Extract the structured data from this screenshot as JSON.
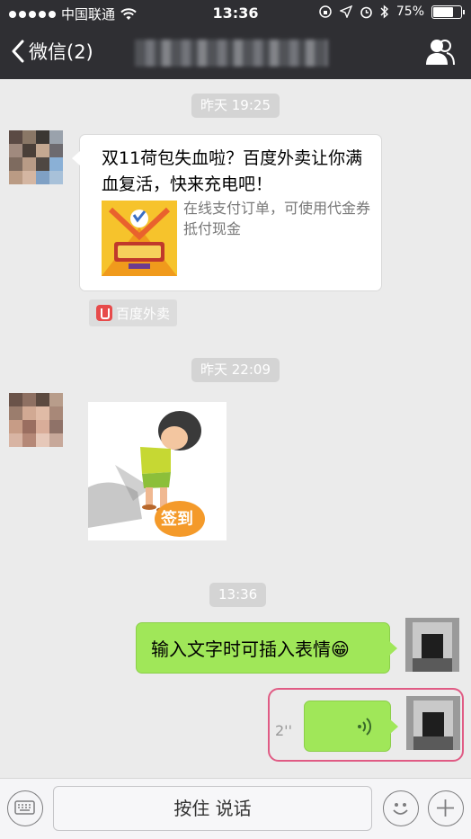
{
  "status_bar": {
    "carrier": "中国联通",
    "time": "13:36",
    "battery_percent": "75%",
    "battery_level": 0.75,
    "signal_bars_filled": 5,
    "icons": [
      "wifi-icon",
      "orientation-lock-icon",
      "location-icon",
      "alarm-icon",
      "bluetooth-icon",
      "battery-icon"
    ]
  },
  "nav": {
    "back_label": "微信(2)",
    "title": "",
    "right_icon": "group-members-icon"
  },
  "messages": {
    "time1": "昨天 19:25",
    "card": {
      "title": "双11荷包失血啦？百度外卖让你满血复活，快来充电吧！",
      "description": "在线支付订单，可使用代金券抵付现金",
      "source": "百度外卖"
    },
    "time2": "昨天 22:09",
    "sticker_text": "签到",
    "time3": "13:36",
    "outgoing_text": "输入文字时可插入表情😁",
    "voice_duration": "2''"
  },
  "input_bar": {
    "hold_to_talk": "按住 说话",
    "left_icon": "keyboard-icon",
    "emoji_icon": "emoji-icon",
    "plus_icon": "plus-icon"
  },
  "colors": {
    "nav_bg": "#2f2f33",
    "chat_bg": "#ebebeb",
    "outgoing_bubble": "#a0e759",
    "highlight": "#e05b84"
  }
}
